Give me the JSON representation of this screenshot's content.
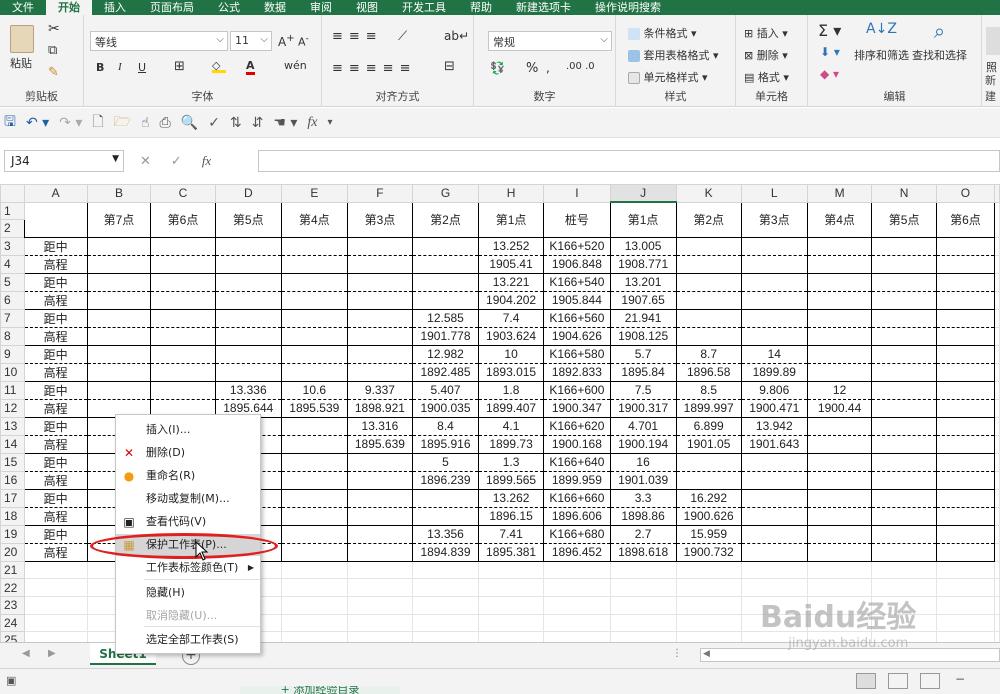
{
  "ribbon_tabs": [
    "文件",
    "开始",
    "插入",
    "页面布局",
    "公式",
    "数据",
    "审阅",
    "视图",
    "开发工具",
    "帮助",
    "新建选项卡",
    "操作说明搜索"
  ],
  "active_tab": "开始",
  "ribbon": {
    "clipboard": {
      "label": "剪贴板",
      "paste": "粘贴"
    },
    "font": {
      "label": "字体",
      "font_name": "等线",
      "font_size": "11",
      "bold": "B",
      "italic": "I",
      "underline": "U"
    },
    "alignment": {
      "label": "对齐方式"
    },
    "number": {
      "label": "数字",
      "format": "常规",
      "percent": "%"
    },
    "styles": {
      "label": "样式",
      "conditional": "条件格式",
      "table": "套用表格格式",
      "cell_styles": "单元格样式"
    },
    "cells": {
      "label": "单元格",
      "insert": "插入",
      "delete": "删除",
      "format": "格式"
    },
    "editing": {
      "label": "编辑",
      "sort_filter": "排序和筛选",
      "find_select": "查找和选择"
    },
    "new_group": {
      "label": "新建",
      "item": "照"
    }
  },
  "name_box": "J34",
  "fx": "fx",
  "column_headers": [
    "A",
    "B",
    "C",
    "D",
    "E",
    "F",
    "G",
    "H",
    "I",
    "J",
    "K",
    "L",
    "M",
    "N",
    "O"
  ],
  "selected_column": "J",
  "header_row": [
    "",
    "第7点",
    "第6点",
    "第5点",
    "第4点",
    "第3点",
    "第2点",
    "第1点",
    "桩号",
    "第1点",
    "第2点",
    "第3点",
    "第4点",
    "第5点",
    "第6点"
  ],
  "rows": [
    [
      "距中",
      "",
      "",
      "",
      "",
      "",
      "",
      "13.252",
      "K166+520",
      "13.005",
      "",
      "",
      "",
      "",
      ""
    ],
    [
      "高程",
      "",
      "",
      "",
      "",
      "",
      "",
      "1905.41",
      "1906.848",
      "1908.771",
      "",
      "",
      "",
      "",
      ""
    ],
    [
      "距中",
      "",
      "",
      "",
      "",
      "",
      "",
      "13.221",
      "K166+540",
      "13.201",
      "",
      "",
      "",
      "",
      ""
    ],
    [
      "高程",
      "",
      "",
      "",
      "",
      "",
      "",
      "1904.202",
      "1905.844",
      "1907.65",
      "",
      "",
      "",
      "",
      ""
    ],
    [
      "距中",
      "",
      "",
      "",
      "",
      "",
      "12.585",
      "7.4",
      "K166+560",
      "21.941",
      "",
      "",
      "",
      "",
      ""
    ],
    [
      "高程",
      "",
      "",
      "",
      "",
      "",
      "1901.778",
      "1903.624",
      "1904.626",
      "1908.125",
      "",
      "",
      "",
      "",
      ""
    ],
    [
      "距中",
      "",
      "",
      "",
      "",
      "",
      "12.982",
      "10",
      "K166+580",
      "5.7",
      "8.7",
      "14",
      "",
      "",
      ""
    ],
    [
      "高程",
      "",
      "",
      "",
      "",
      "",
      "1892.485",
      "1893.015",
      "1892.833",
      "1895.84",
      "1896.58",
      "1899.89",
      "",
      "",
      ""
    ],
    [
      "距中",
      "",
      "",
      "13.336",
      "10.6",
      "9.337",
      "5.407",
      "1.8",
      "K166+600",
      "7.5",
      "8.5",
      "9.806",
      "12",
      "",
      ""
    ],
    [
      "高程",
      "",
      "",
      "1895.644",
      "1895.539",
      "1898.921",
      "1900.035",
      "1899.407",
      "1900.347",
      "1900.317",
      "1899.997",
      "1900.471",
      "1900.44",
      "",
      ""
    ],
    [
      "距中",
      "",
      "",
      "",
      "",
      "13.316",
      "8.4",
      "4.1",
      "K166+620",
      "4.701",
      "6.899",
      "13.942",
      "",
      "",
      ""
    ],
    [
      "高程",
      "",
      "",
      "",
      "",
      "1895.639",
      "1895.916",
      "1899.73",
      "1900.168",
      "1900.194",
      "1901.05",
      "1901.643",
      "",
      "",
      ""
    ],
    [
      "距中",
      "",
      "",
      "",
      "",
      "",
      "5",
      "1.3",
      "K166+640",
      "16",
      "",
      "",
      "",
      "",
      ""
    ],
    [
      "高程",
      "",
      "",
      "",
      "",
      "",
      "1896.239",
      "1899.565",
      "1899.959",
      "1901.039",
      "",
      "",
      "",
      "",
      ""
    ],
    [
      "距中",
      "",
      "",
      "",
      "",
      "",
      "",
      "13.262",
      "K166+660",
      "3.3",
      "16.292",
      "",
      "",
      "",
      ""
    ],
    [
      "高程",
      "",
      "",
      "",
      "",
      "",
      "",
      "1896.15",
      "1896.606",
      "1898.86",
      "1900.626",
      "",
      "",
      "",
      ""
    ],
    [
      "距中",
      "",
      "",
      "",
      "",
      "",
      "13.356",
      "7.41",
      "K166+680",
      "2.7",
      "15.959",
      "",
      "",
      "",
      ""
    ],
    [
      "高程",
      "",
      "",
      "",
      "",
      "",
      "1894.839",
      "1895.381",
      "1896.452",
      "1898.618",
      "1900.732",
      "",
      "",
      "",
      ""
    ]
  ],
  "row_numbers": [
    "1",
    "2",
    "3",
    "4",
    "5",
    "6",
    "7",
    "8",
    "9",
    "10",
    "11",
    "12",
    "13",
    "14",
    "15",
    "16",
    "17",
    "18",
    "19",
    "20",
    "21",
    "22",
    "23",
    "24",
    "25"
  ],
  "sheet_tab": "Sheet1",
  "context_menu": [
    {
      "label": "插入(I)...",
      "icon": "",
      "disabled": false
    },
    {
      "label": "删除(D)",
      "icon": "delete-sheet-icon",
      "disabled": false
    },
    {
      "label": "重命名(R)",
      "icon": "rename-icon",
      "disabled": false
    },
    {
      "label": "移动或复制(M)...",
      "icon": "",
      "disabled": false
    },
    {
      "label": "查看代码(V)",
      "icon": "view-code-icon",
      "disabled": false
    },
    {
      "label": "保护工作表(P)...",
      "icon": "protect-sheet-icon",
      "disabled": false,
      "highlighted": true
    },
    {
      "label": "工作表标签颜色(T)",
      "icon": "",
      "disabled": false,
      "submenu": true
    },
    {
      "label": "隐藏(H)",
      "icon": "",
      "disabled": false
    },
    {
      "label": "取消隐藏(U)...",
      "icon": "",
      "disabled": true
    },
    {
      "label": "选定全部工作表(S)",
      "icon": "",
      "disabled": false
    }
  ],
  "watermark": {
    "line1": "Baidu经验",
    "line2": "jingyan.baidu.com"
  },
  "bottom_peek": "+ 添加经验目录",
  "colors": {
    "brand": "#217346",
    "highlight_oval": "#e02020"
  }
}
